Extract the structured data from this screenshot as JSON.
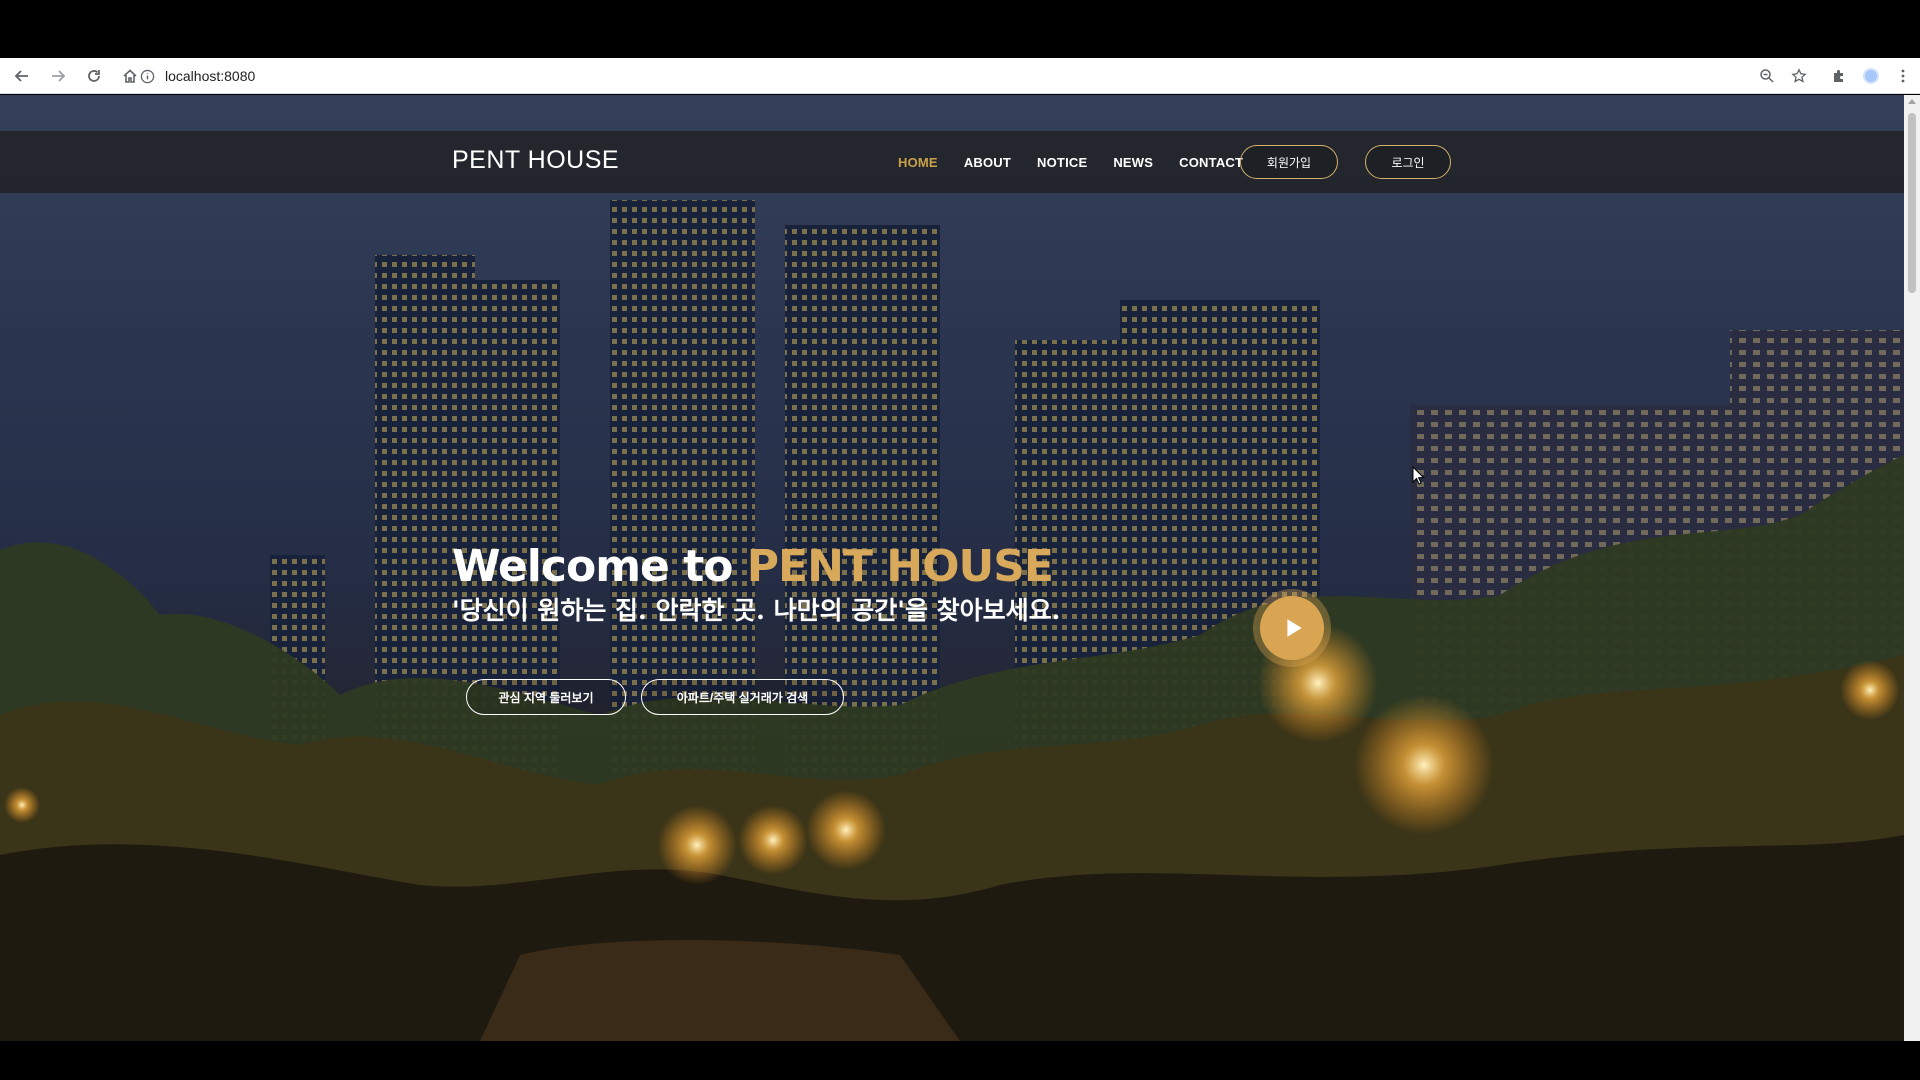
{
  "browser": {
    "url": "localhost:8080"
  },
  "site": {
    "logo": "PENT HOUSE",
    "menu": [
      "HOME",
      "ABOUT",
      "NOTICE",
      "NEWS",
      "CONTACT"
    ],
    "active_menu": "HOME",
    "signup_label": "회원가입",
    "login_label": "로그인"
  },
  "hero": {
    "title_prefix": "Welcome to ",
    "title_accent": "PENT HOUSE",
    "subtitle": "'당신이 원하는 집. 안락한 곳. 나만의 공간'을 찾아보세요.",
    "button_area": "관심 지역 둘러보기",
    "button_search": "아파트/주택 실거래가 검색"
  },
  "colors": {
    "accent": "#d9a95b",
    "active_menu": "#c9a14a",
    "header_bg": "#222428"
  }
}
